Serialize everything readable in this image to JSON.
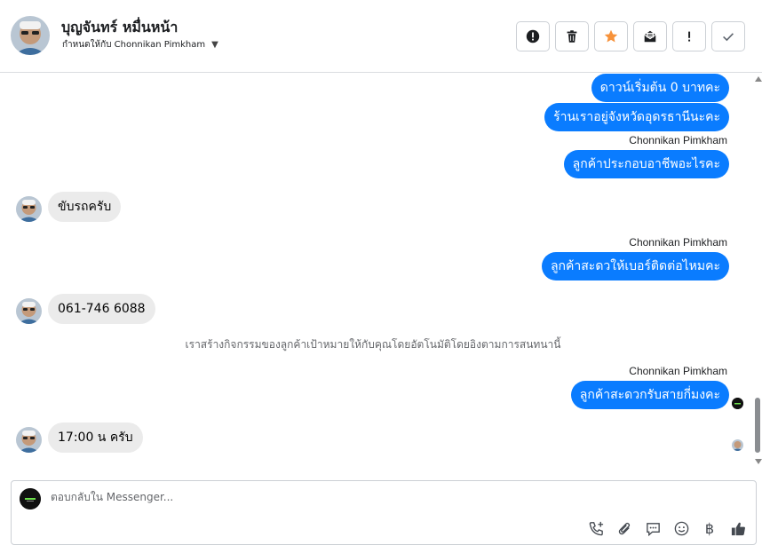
{
  "header": {
    "contact_name": "บุญจันทร์ หมื่นหน้า",
    "assigned_text": "กำหนดให้กับ Chonnikan Pimkham",
    "actions": [
      {
        "name": "report-button",
        "icon": "exclamation-circle-icon"
      },
      {
        "name": "delete-button",
        "icon": "trash-icon"
      },
      {
        "name": "star-button",
        "icon": "star-icon",
        "color": "#f7923a"
      },
      {
        "name": "mark-unread-button",
        "icon": "envelope-open-icon"
      },
      {
        "name": "follow-up-button",
        "icon": "exclamation-icon"
      },
      {
        "name": "mark-done-button",
        "icon": "check-icon"
      }
    ]
  },
  "messages": {
    "out_1": "ดาวน์เริ่มต้น 0 บาทคะ",
    "out_2": "ร้านเราอยู่จังหวัดอุดรธานีนะคะ",
    "sender_1": "Chonnikan Pimkham",
    "out_3": "ลูกค้าประกอบอาชีพอะไรคะ",
    "in_1": "ขับรถครับ",
    "sender_2": "Chonnikan Pimkham",
    "out_4": "ลูกค้าสะดวให้เบอร์ติดต่อไหมคะ",
    "in_2": "061-746 6088",
    "system_note": "เราสร้างกิจกรรมของลูกค้าเป้าหมายให้กับคุณโดยอัตโนมัติโดยอิงตามการสนทนานี้",
    "sender_3": "Chonnikan Pimkham",
    "out_5": "ลูกค้าสะดวกรับสายกี่มงคะ",
    "in_3": "17:00 น ครับ"
  },
  "composer": {
    "placeholder": "ตอบกลับใน Messenger...",
    "tools": [
      "call-icon",
      "attachment-icon",
      "saved-reply-icon",
      "emoji-icon",
      "baht-icon",
      "thumbs-up-icon"
    ],
    "baht_symbol": "฿"
  },
  "colors": {
    "outgoing_bubble": "#0a7cff",
    "incoming_bubble": "#ebebeb",
    "star": "#f7923a"
  }
}
